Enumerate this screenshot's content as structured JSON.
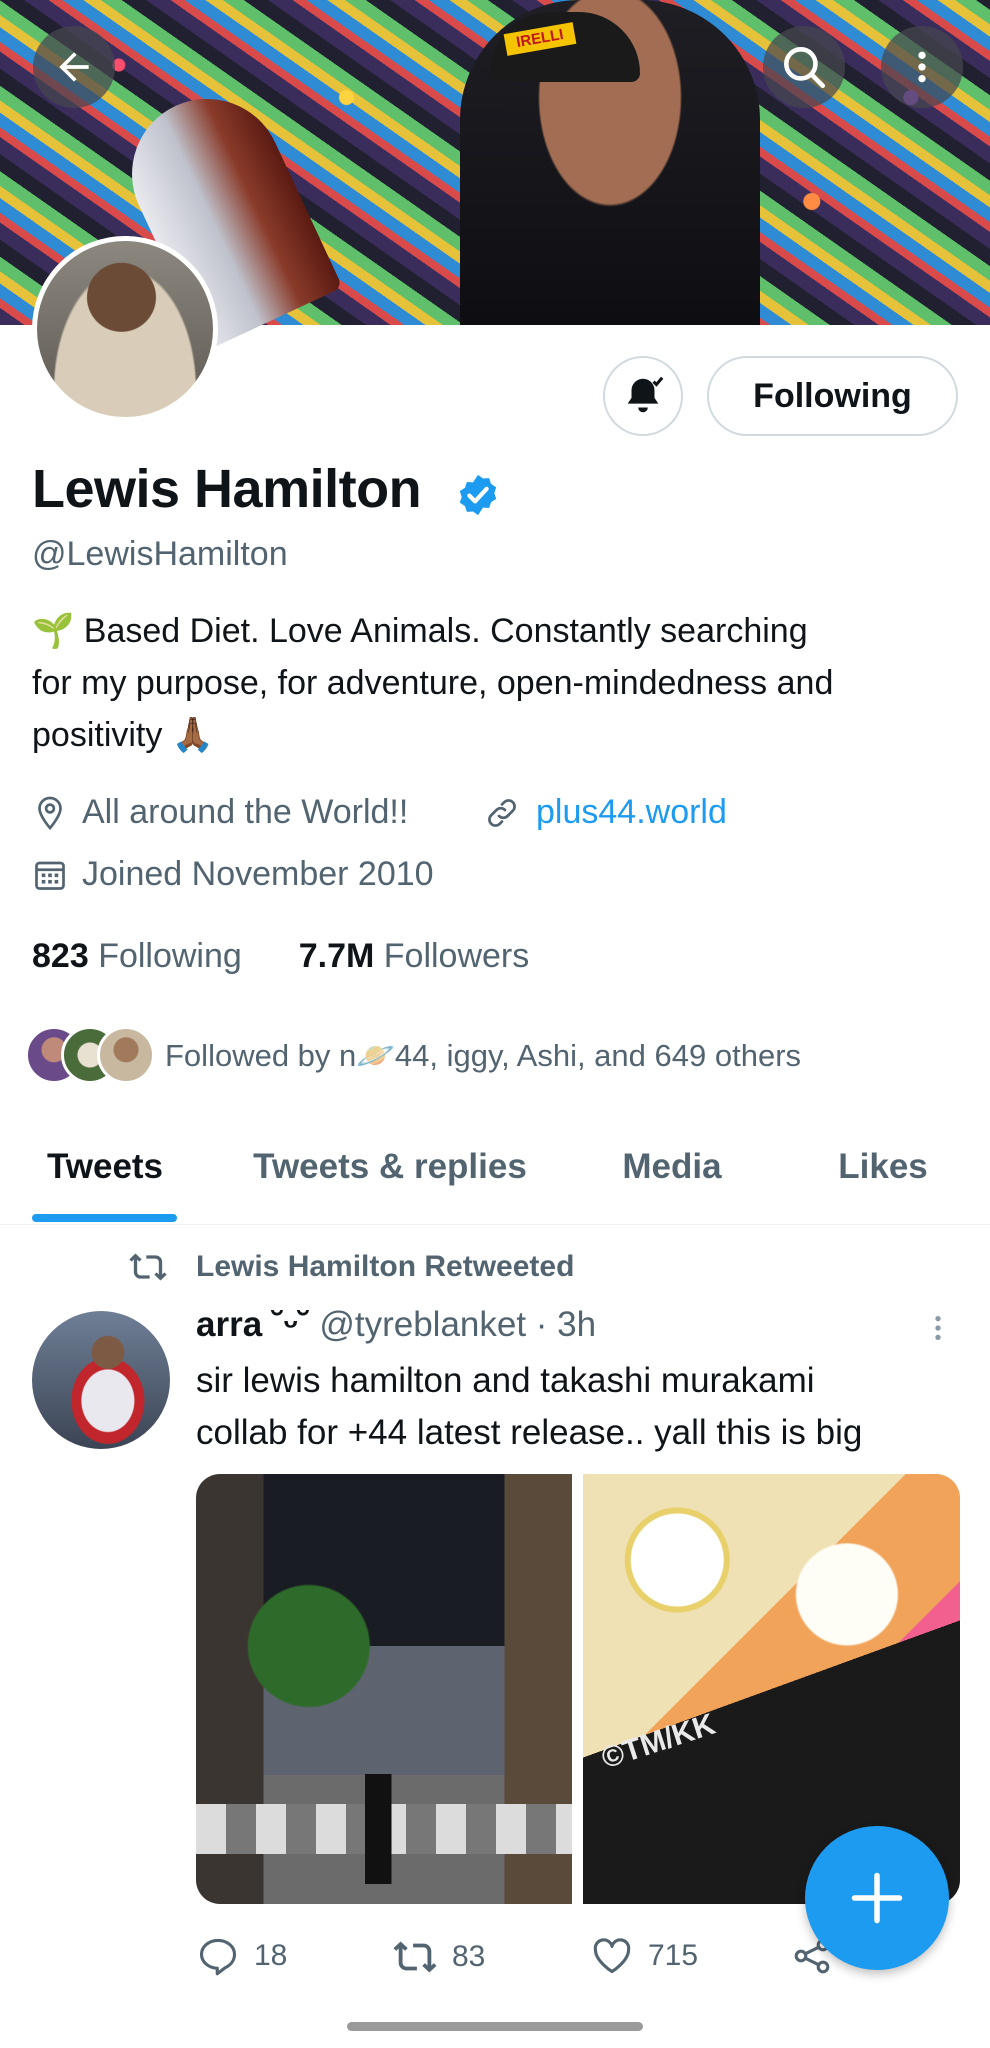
{
  "colors": {
    "accent": "#1d9bf0",
    "text": "#0f1419",
    "secondary": "#536471",
    "border": "#cfd9de"
  },
  "banner": {
    "logo_text": "IRELLI"
  },
  "profile": {
    "name": "Lewis Hamilton",
    "handle": "@LewisHamilton",
    "bio_line1": "🌱 Based Diet. Love Animals. Constantly searching",
    "bio_line2": "for my purpose, for adventure, open-mindedness and",
    "bio_line3": "positivity 🙏🏾",
    "location": "All around the World!!",
    "website": "plus44.world",
    "joined": "Joined November 2010",
    "following_count": "823",
    "following_label": "Following",
    "followers_count": "7.7M",
    "followers_label": "Followers",
    "followed_by": "Followed by n🪐44, iggy, Ashi, and 649 others",
    "follow_button": "Following"
  },
  "tabs": [
    {
      "label": "Tweets",
      "active": true
    },
    {
      "label": "Tweets & replies",
      "active": false
    },
    {
      "label": "Media",
      "active": false
    },
    {
      "label": "Likes",
      "active": false
    }
  ],
  "tweet": {
    "retweet_label": "Lewis Hamilton Retweeted",
    "author_name": "arra ˘ᵕ˘",
    "author_handle": "@tyreblanket",
    "time": " · 3h",
    "text_line1": "sir lewis hamilton and takashi murakami",
    "text_line2": "collab for +44 latest release.. yall this is big",
    "media2_caption": "©TM/KK",
    "replies": "18",
    "retweets": "83",
    "likes": "715"
  }
}
